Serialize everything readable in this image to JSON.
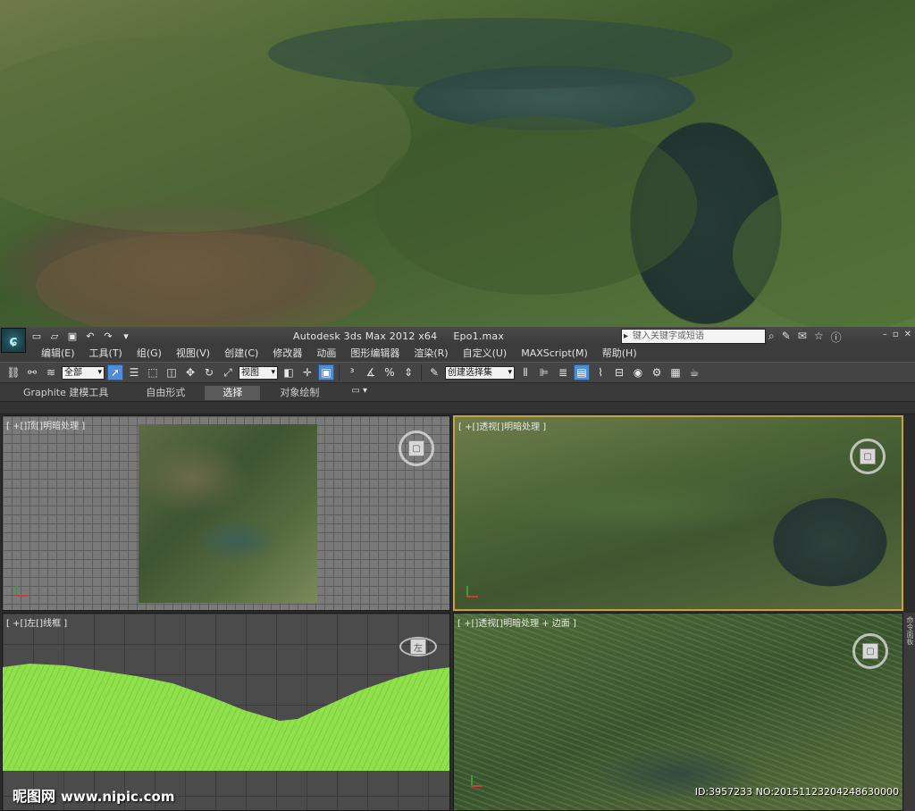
{
  "window": {
    "app_title": "Autodesk 3ds Max  2012 x64",
    "file_name": "Epo1.max",
    "help_search_placeholder": "键入关键字或短语"
  },
  "menu": [
    "编辑(E)",
    "工具(T)",
    "组(G)",
    "视图(V)",
    "创建(C)",
    "修改器",
    "动画",
    "图形编辑器",
    "渲染(R)",
    "自定义(U)",
    "MAXScript(M)",
    "帮助(H)"
  ],
  "toolbar": {
    "selection_filter": "全部",
    "ref_coord": "视图",
    "named_selection": "创建选择集"
  },
  "ribbon": {
    "tabs": [
      "Graphite 建模工具",
      "自由形式",
      "选择",
      "对象绘制"
    ],
    "selected_tab": "选择"
  },
  "viewports": {
    "top": {
      "label": "[ +[]顶[]明暗处理 ]"
    },
    "persp1": {
      "label": "[ +[]透视[]明暗处理 ]"
    },
    "left": {
      "label": "[ +[]左[]线框 ]",
      "cube_label": "左"
    },
    "persp2": {
      "label": "[ +[]透视[]明暗处理 + 边面 ]"
    }
  },
  "command_panel": {
    "label": "命令面板"
  },
  "watermark": {
    "site": "昵图网",
    "url": "www.nipic.com",
    "image_id": "ID:3957233 NO:20151123204248630000"
  },
  "colors": {
    "active_viewport_border": "#c9a23a",
    "wireframe_green": "#8fe04a",
    "active_tool": "#4f8ed4"
  }
}
